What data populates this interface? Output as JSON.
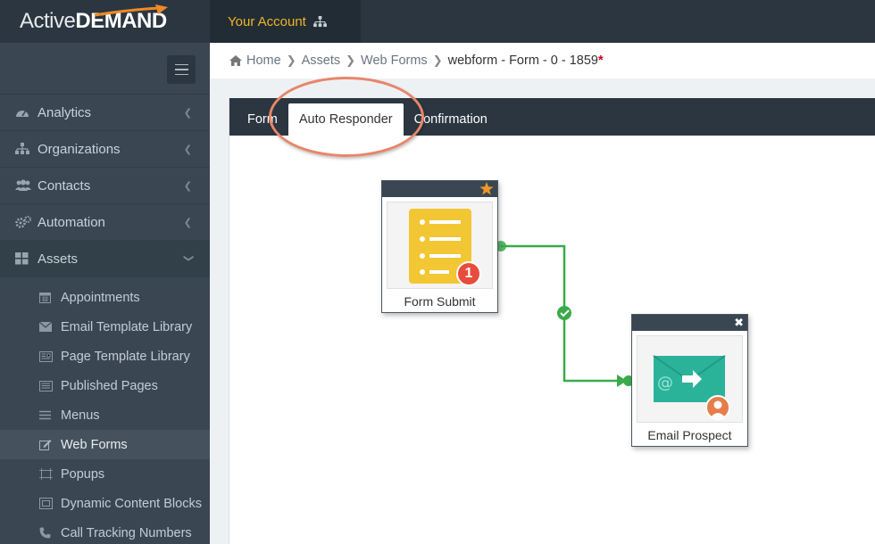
{
  "brand": {
    "part1": "Active",
    "part2": "DEMAND"
  },
  "topbar": {
    "account_label": "Your Account"
  },
  "sidebar": {
    "items": [
      {
        "label": "Analytics",
        "icon": "dashboard-icon"
      },
      {
        "label": "Organizations",
        "icon": "sitemap-icon"
      },
      {
        "label": "Contacts",
        "icon": "users-icon"
      },
      {
        "label": "Automation",
        "icon": "gears-icon"
      },
      {
        "label": "Assets",
        "icon": "grid-icon"
      }
    ],
    "assets_subitems": [
      {
        "label": "Appointments",
        "icon": "calendar-icon"
      },
      {
        "label": "Email Template Library",
        "icon": "envelope-icon"
      },
      {
        "label": "Page Template Library",
        "icon": "page-template-icon"
      },
      {
        "label": "Published Pages",
        "icon": "published-pages-icon"
      },
      {
        "label": "Menus",
        "icon": "menu-bars-icon"
      },
      {
        "label": "Web Forms",
        "icon": "edit-icon"
      },
      {
        "label": "Popups",
        "icon": "popup-icon"
      },
      {
        "label": "Dynamic Content Blocks",
        "icon": "dynamic-content-icon"
      },
      {
        "label": "Call Tracking Numbers",
        "icon": "phone-icon"
      }
    ]
  },
  "breadcrumb": {
    "home": "Home",
    "assets": "Assets",
    "web_forms": "Web Forms",
    "current": "webform - Form - 0 - 1859",
    "unsaved_marker": "*"
  },
  "tabs": [
    {
      "label": "Form"
    },
    {
      "label": "Auto Responder",
      "active": true
    },
    {
      "label": "Confirmation"
    }
  ],
  "workflow": {
    "nodes": [
      {
        "label": "Form Submit",
        "badge": "1"
      },
      {
        "label": "Email Prospect"
      }
    ]
  },
  "colors": {
    "accent_orange": "#f0b429",
    "highlight": "#e8866a",
    "connector_green": "#3aaa4a",
    "badge_red": "#e74c3c",
    "form_icon_yellow": "#f3c634",
    "email_icon_teal": "#2bb39a"
  }
}
